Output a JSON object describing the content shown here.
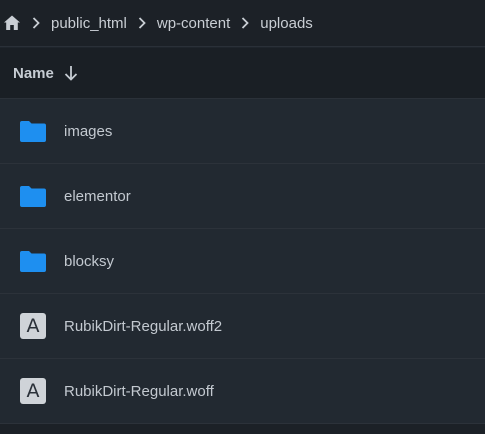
{
  "breadcrumb": {
    "home_icon": "home-icon",
    "items": [
      {
        "label": "public_html"
      },
      {
        "label": "wp-content"
      },
      {
        "label": "uploads"
      }
    ]
  },
  "header": {
    "sort_label": "Name",
    "sort_icon": "arrow-down-icon"
  },
  "colors": {
    "folder": "#1e8ff0",
    "background": "#1f252c",
    "row": "#222931",
    "text": "#c3c9d0"
  },
  "files": [
    {
      "type": "folder",
      "icon": "folder-icon",
      "name": "images"
    },
    {
      "type": "folder",
      "icon": "folder-icon",
      "name": "elementor"
    },
    {
      "type": "folder",
      "icon": "folder-icon",
      "name": "blocksy"
    },
    {
      "type": "font",
      "icon": "font-file-icon",
      "glyph": "A",
      "name": "RubikDirt-Regular.woff2"
    },
    {
      "type": "font",
      "icon": "font-file-icon",
      "glyph": "A",
      "name": "RubikDirt-Regular.woff"
    }
  ]
}
